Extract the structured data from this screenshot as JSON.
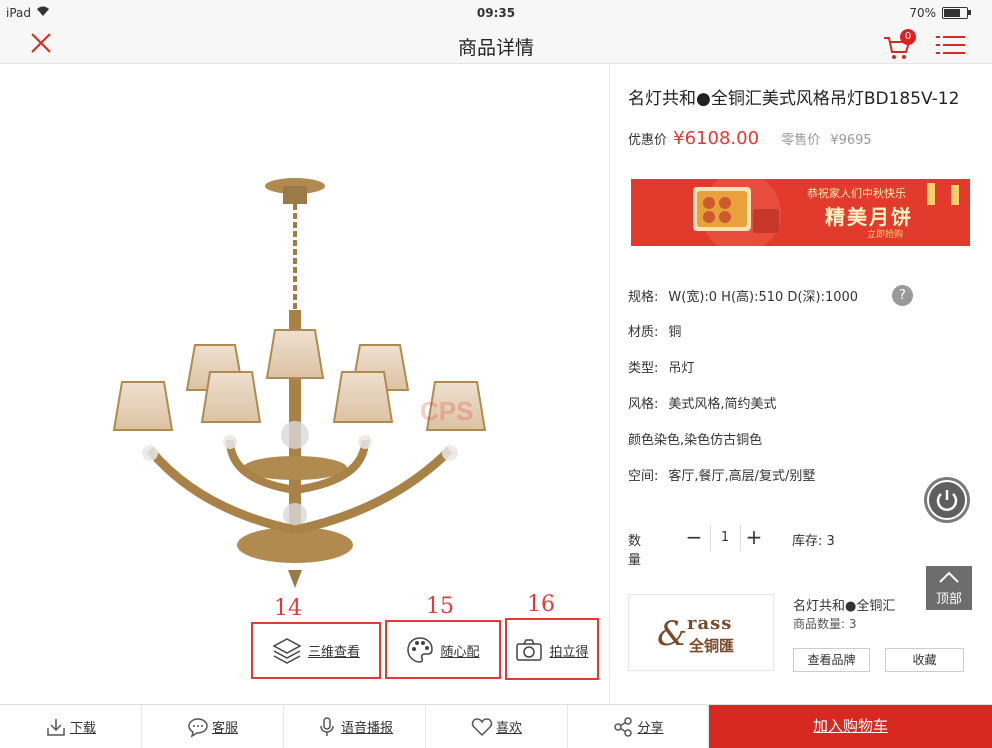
{
  "status_bar": {
    "device": "iPad",
    "time": "09:35",
    "battery": "70%"
  },
  "nav": {
    "title": "商品详情",
    "cart_count": "0"
  },
  "product": {
    "title": "名灯共和●全铜汇美式风格吊灯BD185V-12",
    "price_label": "优惠价",
    "price": "¥6108.00",
    "retail_label": "零售价",
    "retail_price": "¥9695"
  },
  "banner": {
    "line1": "恭祝家人们中秋快乐",
    "line2": "精美月饼",
    "line3": "立即抢购"
  },
  "specs": [
    {
      "key": "规格:",
      "value": "W(宽):0   H(高):510   D(深):1000"
    },
    {
      "key": "材质:",
      "value": "铜"
    },
    {
      "key": "类型:",
      "value": "吊灯"
    },
    {
      "key": "风格:",
      "value": "美式风格,简约美式"
    },
    {
      "key": "颜色染色,染色仿古铜色",
      "value": ""
    },
    {
      "key": "空间:",
      "value": "客厅,餐厅,高层/复式/别墅"
    }
  ],
  "spec_help": "?",
  "quantity": {
    "label": "数量",
    "value": "1",
    "stock": "库存:  3"
  },
  "top_button": "顶部",
  "brand": {
    "logo_text": "rass",
    "logo_cn": "全铜匯",
    "name": "名灯共和●全铜汇",
    "count": "商品数量:  3",
    "view_label": "查看品牌",
    "fav_label": "收藏"
  },
  "image_actions": [
    {
      "label": "三维查看",
      "anno": "14"
    },
    {
      "label": "随心配",
      "anno": "15"
    },
    {
      "label": "拍立得",
      "anno": "16"
    }
  ],
  "watermark": "CPS",
  "bottom_bar": {
    "download": "下载",
    "service": "客服",
    "voice": "语音播报",
    "like": "喜欢",
    "share": "分享",
    "add_cart": "加入购物车"
  },
  "colors": {
    "accent": "#e53935",
    "cart_button": "#d7291f",
    "brass": "#b08a4e"
  }
}
